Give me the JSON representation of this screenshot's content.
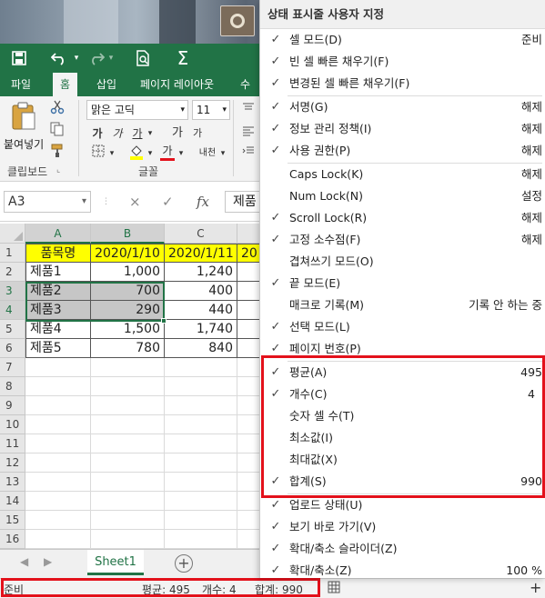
{
  "qat": {
    "save_icon": "save-icon",
    "undo_icon": "undo-icon",
    "redo_icon": "redo-icon",
    "print_preview_icon": "print-preview-icon",
    "autosum_icon": "autosum-icon",
    "sum_glyph": "Σ"
  },
  "tabs": [
    "파일",
    "홈",
    "삽입",
    "페이지 레이아웃",
    "수식"
  ],
  "ribbon": {
    "paste_label": "붙여넣기",
    "clipboard_group": "클립보드",
    "font_group": "글꼴",
    "font_name": "맑은 고딕",
    "font_size": "11",
    "bold": "가",
    "italic": "가",
    "underline": "가",
    "grow_font": "가",
    "shrink_font": "가",
    "phonetic": "내천"
  },
  "formula_bar": {
    "name_box": "A3",
    "cancel": "×",
    "enter": "✓",
    "fx": "fx",
    "content": "제품"
  },
  "grid": {
    "columns": [
      "A",
      "B",
      "C"
    ],
    "row_numbers": [
      "1",
      "2",
      "3",
      "4",
      "5",
      "6",
      "7",
      "8",
      "9",
      "10",
      "11",
      "12",
      "13",
      "14",
      "15",
      "16"
    ],
    "header_row": [
      "품목명",
      "2020/1/10",
      "2020/1/11",
      "20"
    ],
    "rows": [
      [
        "제품1",
        "1,000",
        "1,240"
      ],
      [
        "제품2",
        "700",
        "400"
      ],
      [
        "제품3",
        "290",
        "440"
      ],
      [
        "제품4",
        "1,500",
        "1,740"
      ],
      [
        "제품5",
        "780",
        "840"
      ]
    ]
  },
  "sheet": {
    "tab": "Sheet1",
    "add": "⊕"
  },
  "status_bar": {
    "mode": "준비",
    "average": "평균: 495",
    "count": "개수: 4",
    "sum": "합계: 990"
  },
  "menu": {
    "title": "상태 표시줄 사용자 지정",
    "items": [
      {
        "checked": true,
        "label": "셀 모드(D)",
        "value": "준비"
      },
      {
        "checked": true,
        "label": "빈 셀 빠른 채우기(F)",
        "value": ""
      },
      {
        "checked": true,
        "label": "변경된 셀 빠른 채우기(F)",
        "value": ""
      },
      {
        "checked": true,
        "label": "서명(G)",
        "value": "해제"
      },
      {
        "checked": true,
        "label": "정보 관리 정책(I)",
        "value": "해제"
      },
      {
        "checked": true,
        "label": "사용 권한(P)",
        "value": "해제"
      },
      {
        "checked": false,
        "label": "Caps Lock(K)",
        "value": "해제"
      },
      {
        "checked": false,
        "label": "Num Lock(N)",
        "value": "설정"
      },
      {
        "checked": true,
        "label": "Scroll Lock(R)",
        "value": "해제"
      },
      {
        "checked": true,
        "label": "고정 소수점(F)",
        "value": "해제"
      },
      {
        "checked": false,
        "label": "겹쳐쓰기 모드(O)",
        "value": ""
      },
      {
        "checked": true,
        "label": "끝 모드(E)",
        "value": ""
      },
      {
        "checked": false,
        "label": "매크로 기록(M)",
        "value": "기록 안 하는 중"
      },
      {
        "checked": true,
        "label": "선택 모드(L)",
        "value": ""
      },
      {
        "checked": true,
        "label": "페이지 번호(P)",
        "value": ""
      },
      {
        "checked": true,
        "label": "평균(A)",
        "value": "495"
      },
      {
        "checked": true,
        "label": "개수(C)",
        "value": "4"
      },
      {
        "checked": false,
        "label": "숫자 셀 수(T)",
        "value": ""
      },
      {
        "checked": false,
        "label": "최소값(I)",
        "value": ""
      },
      {
        "checked": false,
        "label": "최대값(X)",
        "value": ""
      },
      {
        "checked": true,
        "label": "합계(S)",
        "value": "990"
      },
      {
        "checked": true,
        "label": "업로드 상태(U)",
        "value": ""
      },
      {
        "checked": true,
        "label": "보기 바로 가기(V)",
        "value": ""
      },
      {
        "checked": true,
        "label": "확대/축소 슬라이더(Z)",
        "value": ""
      },
      {
        "checked": true,
        "label": "확대/축소(Z)",
        "value": "100 %"
      }
    ],
    "check_glyph": "✓"
  },
  "highlight_color": "#e3111b",
  "accent_color": "#217346"
}
